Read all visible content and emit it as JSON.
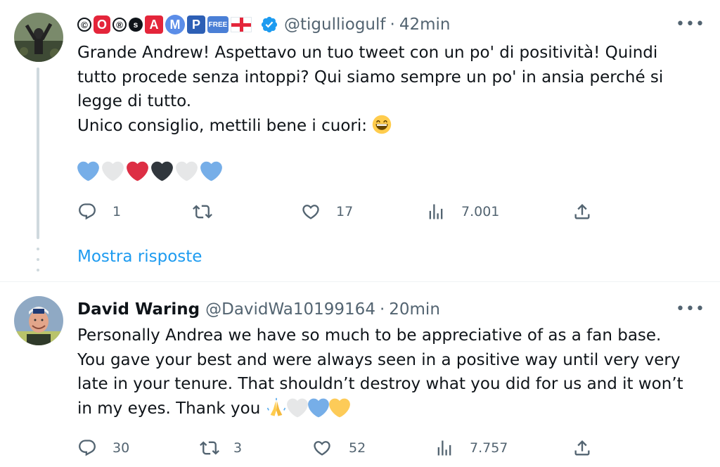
{
  "tweets": [
    {
      "display_name": "©O®sAMP",
      "badges": [
        "©",
        "O",
        "®",
        "s",
        "A",
        "M",
        "P",
        "FREE"
      ],
      "handle": "@tigulliogulf",
      "time": "42min",
      "lines": [
        "Grande Andrew! Aspettavo un tuo tweet con un po' di positività! Quindi",
        "tutto procede senza intoppi? Qui siamo sempre un po' in ansia perché si",
        "legge di tutto.",
        "Unico consiglio, mettili bene i cuori:"
      ],
      "hearts": [
        "blue",
        "white",
        "red",
        "black",
        "white",
        "blue"
      ],
      "replies": "1",
      "retweets": "",
      "likes": "17",
      "views": "7.001",
      "show_replies": "Mostra risposte"
    },
    {
      "display_name": "David Waring",
      "handle": "@DavidWa10199164",
      "time": "20min",
      "lines": [
        "Personally Andrea we have so much to be appreciative of as a fan base.",
        "You gave your best and were always seen in a positive way until very very",
        "late in your tenure. That shouldn’t destroy what you did for us and it won’t",
        "in my eyes. Thank you"
      ],
      "trailing_emoji": [
        "folded-hands",
        "white-heart",
        "blue-heart",
        "yellow-heart"
      ],
      "replies": "30",
      "retweets": "3",
      "likes": "52",
      "views": "7.757"
    }
  ],
  "colors": {
    "link": "#1d9bf0",
    "secondary_text": "#536471",
    "verified": "#1d9bf0",
    "heart_blue": "#76aee8",
    "heart_red": "#dd2e44",
    "heart_black": "#31373d",
    "heart_white": "#e6e7e8",
    "heart_yellow": "#fdcb58"
  }
}
